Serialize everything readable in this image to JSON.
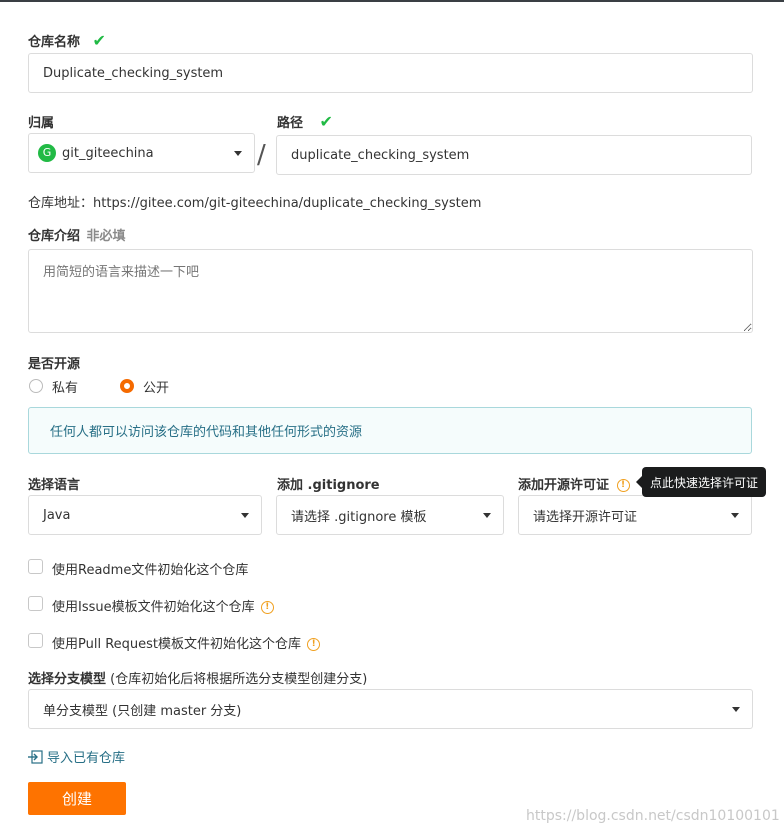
{
  "repo_name": {
    "label": "仓库名称",
    "value": "Duplicate_checking_system"
  },
  "owner": {
    "label": "归属",
    "avatar_letter": "G",
    "value": "git_giteechina",
    "separator": "/"
  },
  "path": {
    "label": "路径",
    "value": "duplicate_checking_system"
  },
  "repo_address": {
    "label": "仓库地址：",
    "url": "https://gitee.com/git-giteechina/duplicate_checking_system"
  },
  "intro": {
    "label": "仓库介绍",
    "optional": "非必填",
    "placeholder": "用简短的语言来描述一下吧"
  },
  "visibility": {
    "label": "是否开源",
    "private": "私有",
    "public": "公开",
    "selected": "public",
    "notice": "任何人都可以访问该仓库的代码和其他任何形式的资源"
  },
  "language": {
    "label": "选择语言",
    "value": "Java"
  },
  "gitignore": {
    "label": "添加 .gitignore",
    "value": "请选择 .gitignore 模板"
  },
  "license": {
    "label": "添加开源许可证",
    "value": "请选择开源许可证",
    "tooltip": "点此快速选择许可证"
  },
  "options": {
    "readme": "使用Readme文件初始化这个仓库",
    "issue": "使用Issue模板文件初始化这个仓库",
    "pr": "使用Pull Request模板文件初始化这个仓库"
  },
  "branch_model": {
    "label": "选择分支模型",
    "hint": "(仓库初始化后将根据所选分支模型创建分支)",
    "value": "单分支模型 (只创建 master 分支)"
  },
  "import_link": "导入已有仓库",
  "create_button": "创建",
  "watermark": "https://blog.csdn.net/csdn10100101",
  "colors": {
    "accent": "#fe7300",
    "check": "#21ba45",
    "notice_bg": "#f5fcfc",
    "notice_text": "#276f86",
    "info": "#f0a020",
    "avatar": "#21ba45"
  },
  "icons": {
    "valid": "check-icon",
    "info": "info-icon",
    "import": "import-icon",
    "dropdown": "caret-down-icon"
  }
}
